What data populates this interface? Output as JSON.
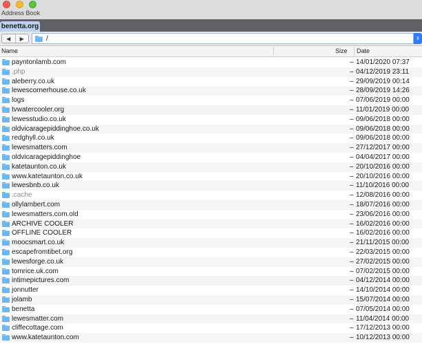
{
  "window": {
    "title": "Address Book"
  },
  "tab": {
    "label": "benetta.org"
  },
  "path": {
    "value": "/",
    "popup_icon": "chevron-updown-icon"
  },
  "nav": {
    "back_icon": "back-arrow-icon",
    "forward_icon": "forward-arrow-icon"
  },
  "columns": {
    "name": "Name",
    "size": "Size",
    "date": "Date"
  },
  "files": [
    {
      "name": "payntonlamb.com",
      "size": "–",
      "date": "14/01/2020 07:37",
      "dim": false
    },
    {
      "name": ".php",
      "size": "–",
      "date": "04/12/2019 23:11",
      "dim": true
    },
    {
      "name": "aleberry.co.uk",
      "size": "–",
      "date": "29/09/2019 00:14",
      "dim": false
    },
    {
      "name": "lewescornerhouse.co.uk",
      "size": "–",
      "date": "28/09/2019 14:26",
      "dim": false
    },
    {
      "name": "logs",
      "size": "–",
      "date": "07/06/2019 00:00",
      "dim": false
    },
    {
      "name": "tvwatercooler.org",
      "size": "–",
      "date": "11/01/2019 00:00",
      "dim": false
    },
    {
      "name": "lewesstudio.co.uk",
      "size": "–",
      "date": "09/06/2018 00:00",
      "dim": false
    },
    {
      "name": "oldvicaragepiddinghoe.co.uk",
      "size": "–",
      "date": "09/06/2018 00:00",
      "dim": false
    },
    {
      "name": "redghyll.co.uk",
      "size": "–",
      "date": "09/06/2018 00:00",
      "dim": false
    },
    {
      "name": "lewesmatters.com",
      "size": "–",
      "date": "27/12/2017 00:00",
      "dim": false
    },
    {
      "name": "oldvicaragepiddinghoe",
      "size": "–",
      "date": "04/04/2017 00:00",
      "dim": false
    },
    {
      "name": "katetaunton.co.uk",
      "size": "–",
      "date": "20/10/2016 00:00",
      "dim": false
    },
    {
      "name": "www.katetaunton.co.uk",
      "size": "–",
      "date": "20/10/2016 00:00",
      "dim": false
    },
    {
      "name": "lewesbnb.co.uk",
      "size": "–",
      "date": "11/10/2016 00:00",
      "dim": false
    },
    {
      "name": ".cache",
      "size": "–",
      "date": "12/08/2016 00:00",
      "dim": true
    },
    {
      "name": "ollylambert.com",
      "size": "–",
      "date": "18/07/2016 00:00",
      "dim": false
    },
    {
      "name": "lewesmatters.com.old",
      "size": "–",
      "date": "23/06/2016 00:00",
      "dim": false
    },
    {
      "name": "ARCHIVE COOLER",
      "size": "–",
      "date": "16/02/2016 00:00",
      "dim": false
    },
    {
      "name": "OFFLINE COOLER",
      "size": "–",
      "date": "16/02/2016 00:00",
      "dim": false
    },
    {
      "name": "moocsmart.co.uk",
      "size": "–",
      "date": "21/11/2015 00:00",
      "dim": false
    },
    {
      "name": "escapefromtibet.org",
      "size": "–",
      "date": "22/03/2015 00:00",
      "dim": false
    },
    {
      "name": "lewesforge.co.uk",
      "size": "–",
      "date": "27/02/2015 00:00",
      "dim": false
    },
    {
      "name": "tomrice.uk.com",
      "size": "–",
      "date": "07/02/2015 00:00",
      "dim": false
    },
    {
      "name": "intimepictures.com",
      "size": "–",
      "date": "04/12/2014 00:00",
      "dim": false
    },
    {
      "name": "jonnutter",
      "size": "–",
      "date": "14/10/2014 00:00",
      "dim": false
    },
    {
      "name": "jolamb",
      "size": "–",
      "date": "15/07/2014 00:00",
      "dim": false
    },
    {
      "name": "benetta",
      "size": "–",
      "date": "07/05/2014 00:00",
      "dim": false
    },
    {
      "name": "lewesmatter.com",
      "size": "–",
      "date": "11/04/2014 00:00",
      "dim": false
    },
    {
      "name": "cliffecottage.com",
      "size": "–",
      "date": "17/12/2013 00:00",
      "dim": false
    },
    {
      "name": "www.katetaunton.com",
      "size": "–",
      "date": "10/12/2013 00:00",
      "dim": false
    }
  ]
}
